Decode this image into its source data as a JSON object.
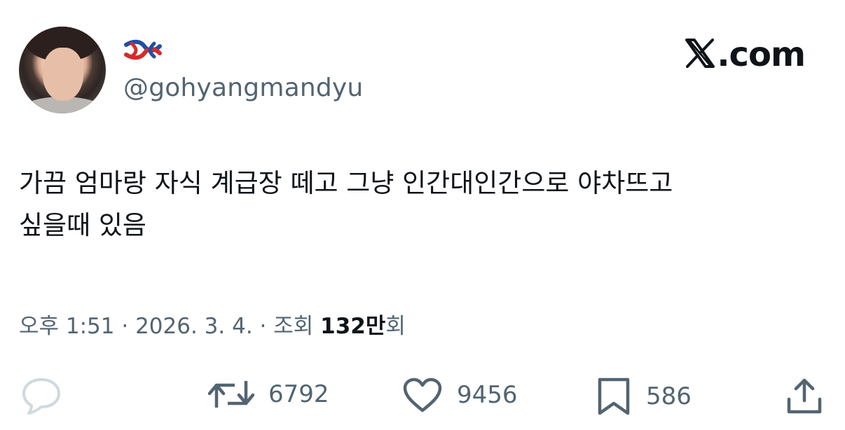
{
  "author": {
    "display_name_icon": "red-blue-knot-emoji",
    "handle": "@gohyangmandyu"
  },
  "brand": {
    "label": ".com",
    "icon": "x-logo-icon"
  },
  "tweet": {
    "lines": [
      "가끔 엄마랑 자식 계급장 떼고 그냥 인간대인간으로 야차뜨고",
      "싶을때 있음"
    ]
  },
  "meta": {
    "time": "오후 1:51",
    "separator": " · ",
    "date": "2026. 3. 4.",
    "views_label": "조회 ",
    "views_value": "132만",
    "views_suffix": "회"
  },
  "actions": {
    "reply_count": "",
    "retweet_count": "6792",
    "like_count": "9456",
    "bookmark_count": "586"
  },
  "colors": {
    "text": "#0f1419",
    "secondary": "#536471",
    "reply_icon": "#cfd9de"
  }
}
